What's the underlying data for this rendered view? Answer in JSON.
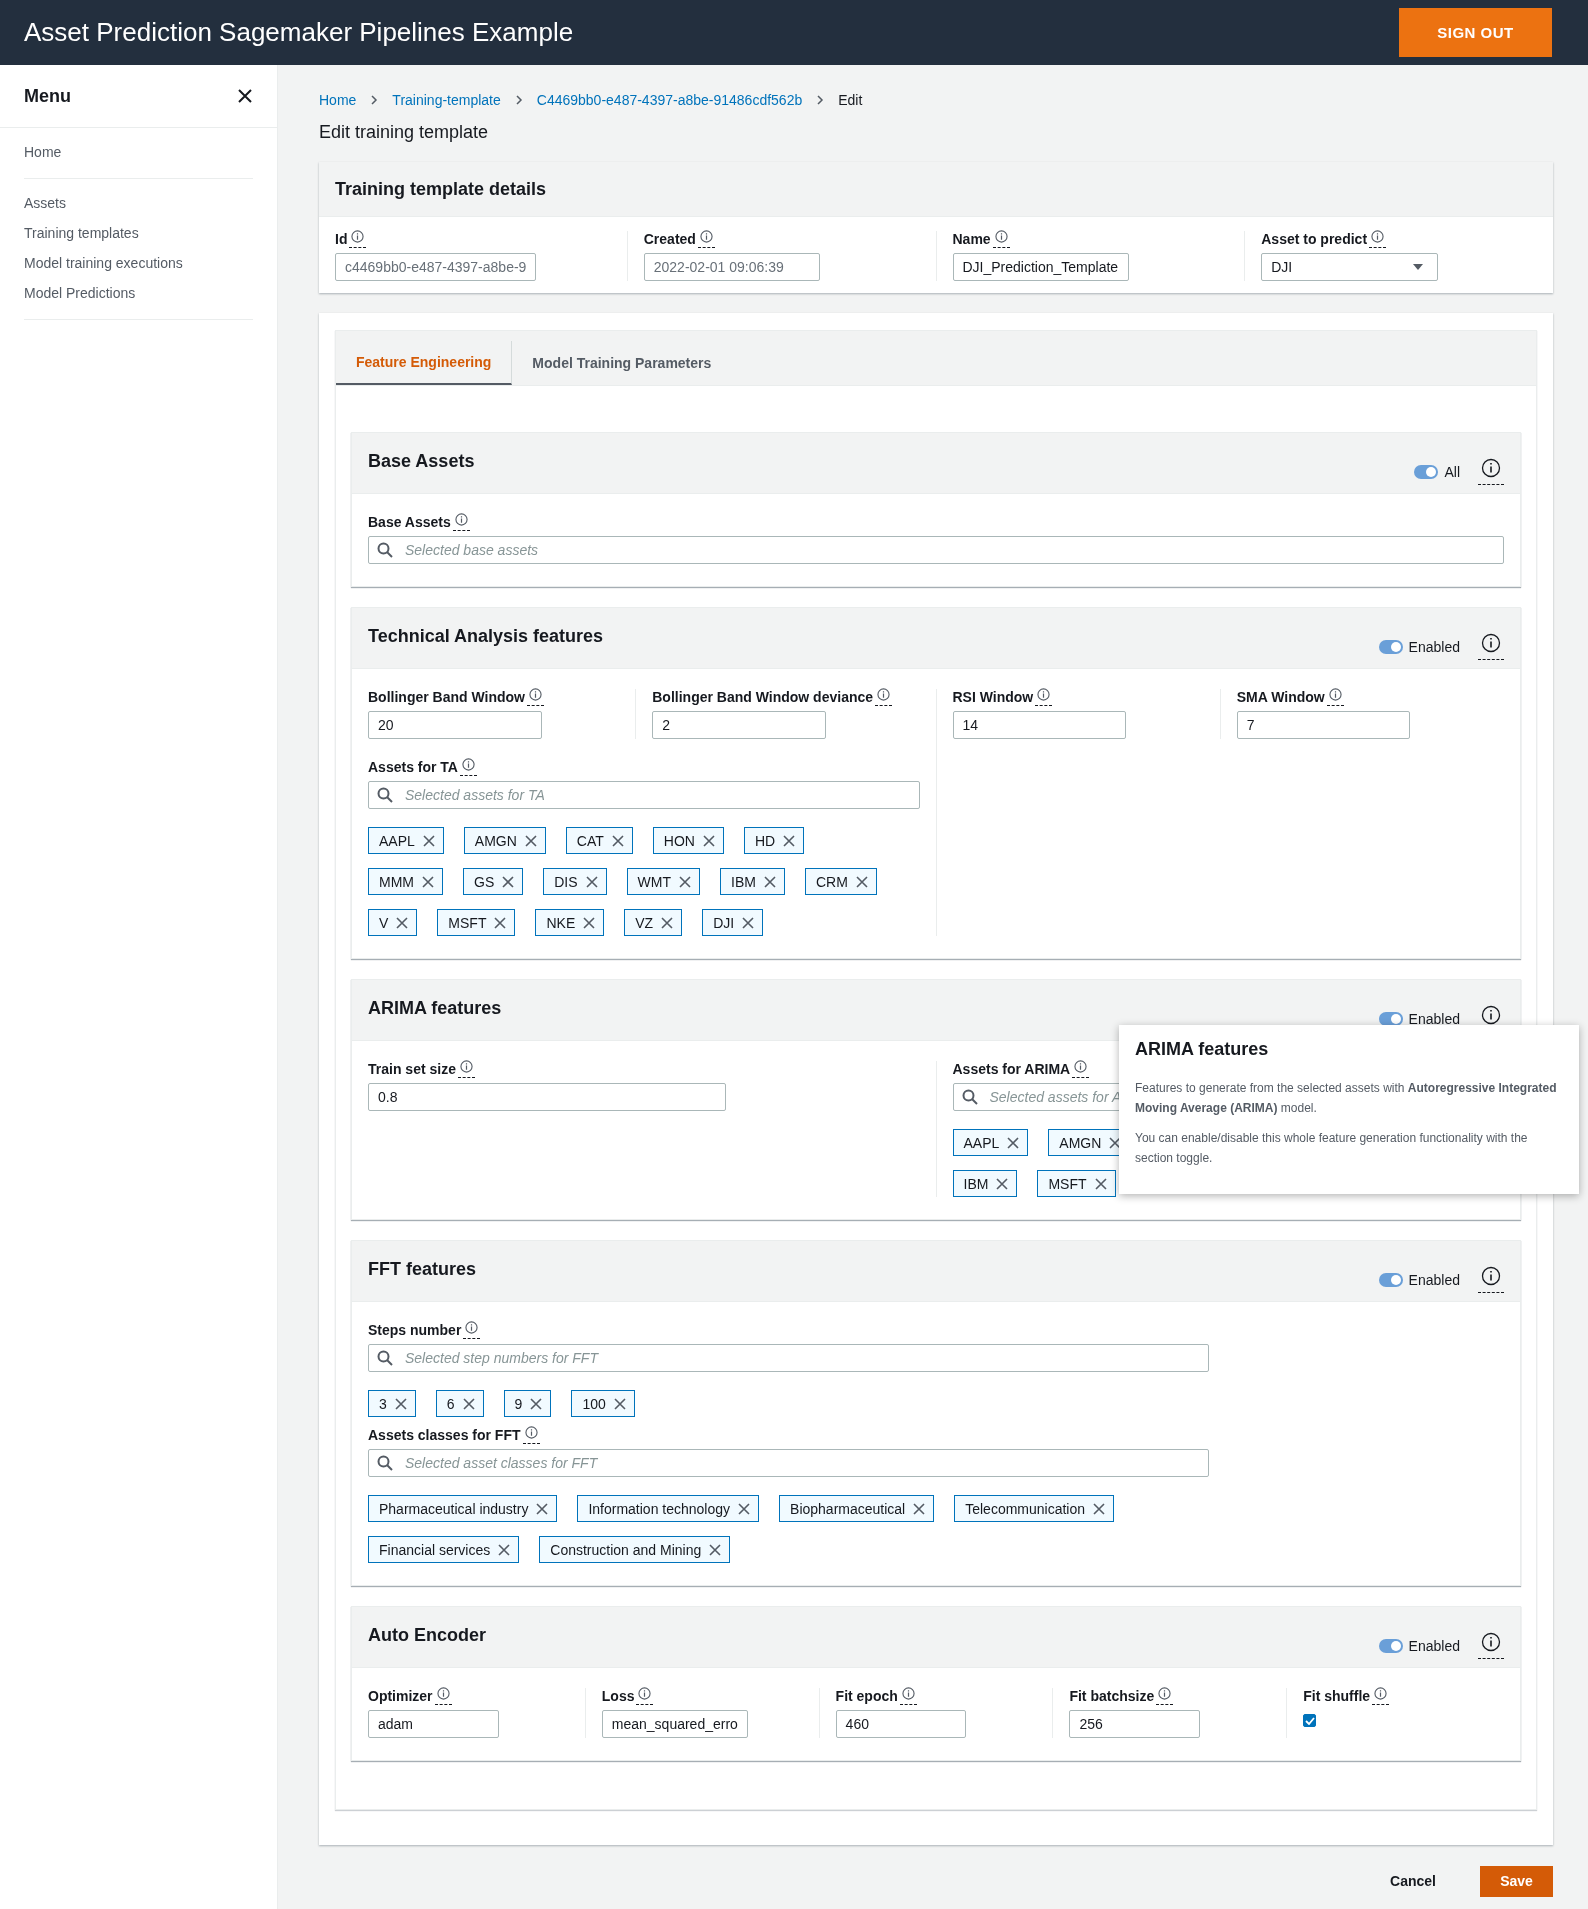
{
  "header": {
    "title": "Asset Prediction Sagemaker Pipelines Example",
    "sign_out": "SIGN OUT"
  },
  "sidebar": {
    "title": "Menu",
    "groups": [
      [
        "Home"
      ],
      [
        "Assets",
        "Training templates",
        "Model training executions",
        "Model Predictions"
      ]
    ]
  },
  "breadcrumbs": [
    {
      "label": "Home",
      "link": true
    },
    {
      "label": "Training-template",
      "link": true
    },
    {
      "label": "C4469bb0-e487-4397-a8be-91486cdf562b",
      "link": true
    },
    {
      "label": "Edit",
      "link": false
    }
  ],
  "page_title": "Edit training template",
  "details": {
    "title": "Training template details",
    "fields": [
      {
        "label": "Id",
        "value": "c4469bb0-e487-4397-a8be-9",
        "kind": "readonly"
      },
      {
        "label": "Created",
        "value": "2022-02-01 09:06:39",
        "kind": "readonly"
      },
      {
        "label": "Name",
        "value": "DJI_Prediction_Template",
        "kind": "input"
      },
      {
        "label": "Asset to predict",
        "value": "DJI",
        "kind": "select"
      }
    ]
  },
  "tabs": [
    {
      "label": "Feature Engineering",
      "selected": true
    },
    {
      "label": "Model Training Parameters",
      "selected": false
    }
  ],
  "sections": [
    {
      "title": "Base Assets",
      "toggle": {
        "label": "All",
        "on": true
      },
      "columns": [
        [
          {
            "kind": "search",
            "label": "Base Assets",
            "placeholder": "Selected base assets"
          }
        ]
      ]
    },
    {
      "title": "Technical Analysis features",
      "toggle": {
        "label": "Enabled",
        "on": true
      },
      "columns": [
        [
          {
            "kind": "row",
            "fields": [
              {
                "kind": "input",
                "label": "Bollinger Band Window",
                "value": "20"
              },
              {
                "kind": "input",
                "label": "Bollinger Band Window deviance",
                "value": "2"
              }
            ]
          },
          {
            "kind": "search",
            "label": "Assets for TA",
            "placeholder": "Selected assets for TA",
            "tag_rows": [
              [
                "AAPL",
                "AMGN",
                "CAT",
                "HON",
                "HD"
              ],
              [
                "MMM",
                "GS",
                "DIS",
                "WMT",
                "IBM",
                "CRM"
              ],
              [
                "V",
                "MSFT",
                "NKE",
                "VZ",
                "DJI"
              ]
            ]
          }
        ],
        [
          {
            "kind": "row",
            "fields": [
              {
                "kind": "input",
                "label": "RSI Window",
                "value": "14"
              },
              {
                "kind": "input",
                "label": "SMA Window",
                "value": "7"
              }
            ]
          }
        ]
      ]
    },
    {
      "title": "ARIMA features",
      "toggle": {
        "label": "Enabled",
        "on": true
      },
      "columns": [
        [
          {
            "kind": "input",
            "label": "Train set size",
            "value": "0.8"
          }
        ],
        [
          {
            "kind": "search",
            "label": "Assets for ARIMA",
            "placeholder": "Selected assets for A",
            "tag_rows": [
              [
                "AAPL",
                "AMGN"
              ],
              [
                "IBM",
                "MSFT"
              ]
            ]
          }
        ]
      ],
      "popover": {
        "title": "ARIMA features",
        "paragraphs": [
          "Features to generate from the selected assets with **Autoregressive Integrated Moving Average (ARIMA)** model.",
          "You can enable/disable this whole feature generation functionality with the section toggle."
        ]
      }
    },
    {
      "title": "FFT features",
      "toggle": {
        "label": "Enabled",
        "on": true
      },
      "columns": [
        [
          {
            "kind": "search",
            "label": "Steps number",
            "placeholder": "Selected step numbers for FFT",
            "tag_rows": [
              [
                "3",
                "6",
                "9",
                "100"
              ]
            ]
          },
          {
            "kind": "search",
            "label": "Assets classes for FFT",
            "placeholder": "Selected asset classes for FFT",
            "tag_rows": [
              [
                "Pharmaceutical industry",
                "Information technology",
                "Biopharmaceutical",
                "Telecommunication"
              ],
              [
                "Financial services",
                "Construction and Mining"
              ]
            ]
          }
        ]
      ]
    },
    {
      "title": "Auto Encoder",
      "toggle": {
        "label": "Enabled",
        "on": true
      },
      "columns": [
        [
          {
            "kind": "input",
            "label": "Optimizer",
            "value": "adam"
          }
        ],
        [
          {
            "kind": "input",
            "label": "Loss",
            "value": "mean_squared_erro"
          }
        ],
        [
          {
            "kind": "input",
            "label": "Fit epoch",
            "value": "460"
          }
        ],
        [
          {
            "kind": "input",
            "label": "Fit batchsize",
            "value": "256"
          }
        ],
        [
          {
            "kind": "checkbox",
            "label": "Fit shuffle",
            "checked": true
          }
        ]
      ]
    }
  ],
  "footer": {
    "cancel": "Cancel",
    "save": "Save"
  }
}
